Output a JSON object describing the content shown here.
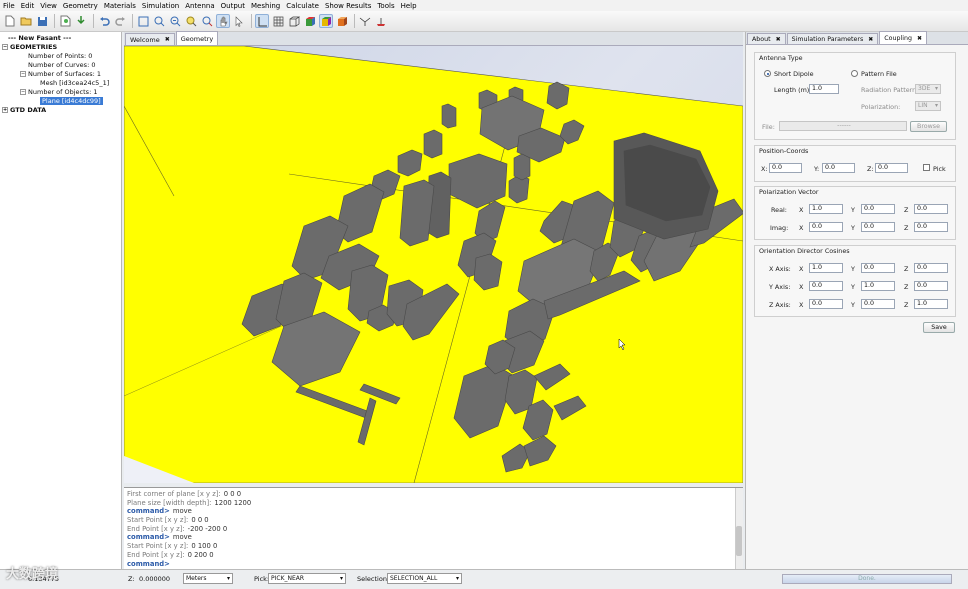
{
  "menu": [
    "File",
    "Edit",
    "View",
    "Geometry",
    "Materials",
    "Simulation",
    "Antenna",
    "Output",
    "Meshing",
    "Calculate",
    "Show Results",
    "Tools",
    "Help"
  ],
  "tree": {
    "root": "--- New Fasant ---",
    "geometries": "GEOMETRIES",
    "points": "Number of Points: 0",
    "curves": "Number of Curves: 0",
    "surfaces": "Number of Surfaces: 1",
    "mesh": "Mesh [id3cea24c5_1]",
    "objects": "Number of Objects: 1",
    "plane": "Plane [id4c4dc99]",
    "gtd": "GTD DATA"
  },
  "doc_tabs": [
    "Welcome",
    "Geometry"
  ],
  "console": [
    {
      "label": "First corner of plane [x y z]:",
      "value": "0 0 0"
    },
    {
      "label": "Plane size [width depth]:",
      "value": "1200 1200"
    },
    {
      "cmd": "command>",
      "value": "move"
    },
    {
      "label": "Start Point [x y z]:",
      "value": "0 0 0"
    },
    {
      "label": "End Point [x y z]:",
      "value": "-200 -200 0"
    },
    {
      "cmd": "command>",
      "value": "move"
    },
    {
      "label": "Start Point [x y z]:",
      "value": "0 100 0"
    },
    {
      "label": "End Point [x y z]:",
      "value": "0 200 0"
    },
    {
      "cmd": "command>",
      "value": ""
    }
  ],
  "right_tabs": [
    "About",
    "Simulation Parameters",
    "Coupling"
  ],
  "antenna": {
    "title": "Antenna Type",
    "short_dipole": "Short Dipole",
    "pattern_file": "Pattern File",
    "length_label": "Length (m):",
    "length_value": "1.0",
    "radiation_label": "Radiation Pattern:",
    "radiation_value": "3DE",
    "polarization_label": "Polarization:",
    "polarization_value": "LIN",
    "file_label": "File:",
    "file_value": "------",
    "browse": "Browse"
  },
  "position": {
    "title": "Position-Coords",
    "x_label": "X:",
    "x": "0.0",
    "y_label": "Y:",
    "y": "0.0",
    "z_label": "Z:",
    "z": "0.0",
    "pick": "Pick"
  },
  "polarization": {
    "title": "Polarization Vector",
    "real": "Real:",
    "imag": "Imag:",
    "real_x": "1.0",
    "real_y": "0.0",
    "real_z": "0.0",
    "imag_x": "0.0",
    "imag_y": "0.0",
    "imag_z": "0.0"
  },
  "orientation": {
    "title": "Orientation Director Cosines",
    "xaxis": "X Axis:",
    "yaxis": "Y Axis:",
    "zaxis": "Z Axis:",
    "xx": "1.0",
    "xy": "0.0",
    "xz": "0.0",
    "yx": "0.0",
    "yy": "1.0",
    "yz": "0.0",
    "zx": "0.0",
    "zy": "0.0",
    "zz": "1.0"
  },
  "axis_letters": {
    "x": "X",
    "y": "Y",
    "z": "Z"
  },
  "save": "Save",
  "status": {
    "coords": "6.134775",
    "z_label": "Z:",
    "z_value": "0.000000",
    "units": "Meters",
    "pick_label": "Pick:",
    "pick_value": "PICK_NEAR",
    "selection_label": "Selection:",
    "selection_value": "SELECTION_ALL",
    "progress": "Done."
  },
  "watermark": "大数跨境",
  "colors": {
    "ground": "#ffff00",
    "buildings": "#6e6e6e",
    "accent": "#3a7bd5"
  }
}
